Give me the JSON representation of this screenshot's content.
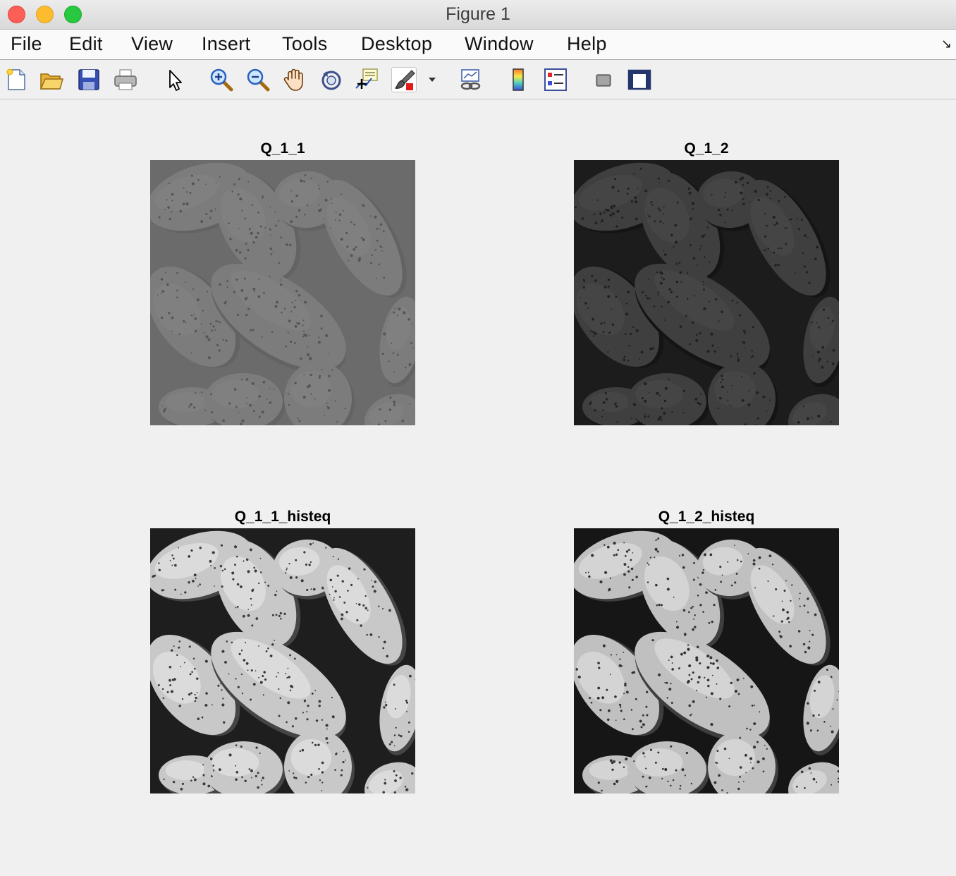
{
  "window": {
    "title": "Figure 1"
  },
  "menu": [
    "File",
    "Edit",
    "View",
    "Insert",
    "Tools",
    "Desktop",
    "Window",
    "Help"
  ],
  "toolbar": [
    {
      "icon": "new-figure-icon"
    },
    {
      "icon": "open-file-icon"
    },
    {
      "icon": "save-icon"
    },
    {
      "icon": "print-icon"
    },
    {
      "icon": "edit-plot-arrow-icon"
    },
    {
      "icon": "zoom-in-icon"
    },
    {
      "icon": "zoom-out-icon"
    },
    {
      "icon": "pan-hand-icon"
    },
    {
      "icon": "rotate-3d-icon"
    },
    {
      "icon": "data-cursor-icon"
    },
    {
      "icon": "brush-icon",
      "pressed": true
    },
    {
      "icon": "link-plot-icon"
    },
    {
      "icon": "colorbar-icon"
    },
    {
      "icon": "legend-icon"
    },
    {
      "icon": "hide-plot-tools-icon"
    },
    {
      "icon": "show-plot-tools-icon"
    }
  ],
  "axes": [
    {
      "title": "Q_1_1",
      "background": "#6b6b6b",
      "grain": "#7c7c7c",
      "dark": "#636363",
      "light": "#858585",
      "dots": "#555555"
    },
    {
      "title": "Q_1_2",
      "background": "#1c1c1c",
      "grain": "#3f3f3f",
      "dark": "#141414",
      "light": "#4e4e4e",
      "dots": "#202020"
    },
    {
      "title": "Q_1_1_histeq",
      "background": "#1e1e1e",
      "grain": "#c8c8c8",
      "dark": "#454545",
      "light": "#f2f2f2",
      "dots": "#3a3a3a"
    },
    {
      "title": "Q_1_2_histeq",
      "background": "#161616",
      "grain": "#c0c0c0",
      "dark": "#3e3e3e",
      "light": "#eeeeee",
      "dots": "#333333"
    }
  ]
}
